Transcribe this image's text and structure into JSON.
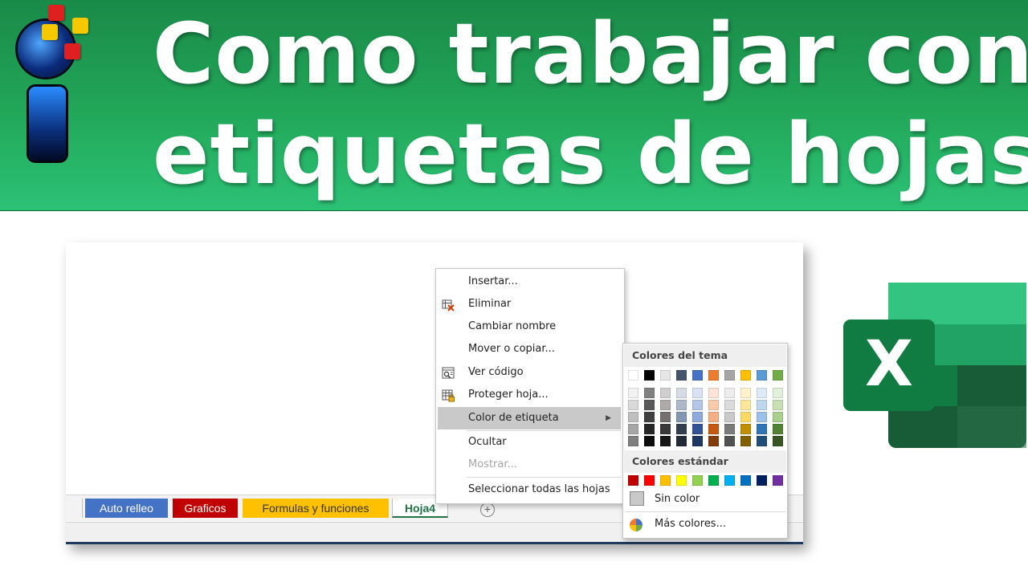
{
  "banner": {
    "title_line1": "Como trabajar con",
    "title_line2": "etiquetas de hojas"
  },
  "tabs": [
    {
      "label": "Auto relleo",
      "color": "#4472C4",
      "text_color": "#ffffff"
    },
    {
      "label": "Graficos",
      "color": "#C00000",
      "text_color": "#ffffff"
    },
    {
      "label": "Formulas y funciones",
      "color": "#FFC000",
      "text_color": "#333333"
    },
    {
      "label": "Hoja4",
      "color": "#ffffff",
      "text_color": "#217346",
      "active": true
    }
  ],
  "new_sheet_symbol": "+",
  "context_menu": {
    "items": [
      {
        "label": "Insertar...",
        "icon": ""
      },
      {
        "label": "Eliminar",
        "icon": "delete-sheet-icon"
      },
      {
        "label": "Cambiar nombre",
        "icon": ""
      },
      {
        "label": "Mover o copiar...",
        "icon": ""
      },
      {
        "label": "Ver código",
        "icon": "view-code-icon"
      },
      {
        "label": "Proteger hoja...",
        "icon": "protect-sheet-icon"
      },
      {
        "label": "Color de etiqueta",
        "icon": "",
        "submenu_arrow": "▶",
        "state": "highlighted"
      },
      {
        "label": "Ocultar",
        "icon": ""
      },
      {
        "label": "Mostrar...",
        "icon": "",
        "state": "disabled"
      },
      {
        "label": "Seleccionar todas las hojas",
        "icon": ""
      }
    ]
  },
  "color_palette": {
    "theme_header": "Colores del tema",
    "theme_colors": [
      "#FFFFFF",
      "#000000",
      "#E7E6E6",
      "#44546A",
      "#4472C4",
      "#ED7D31",
      "#A5A5A5",
      "#FFC000",
      "#5B9BD5",
      "#70AD47"
    ],
    "theme_shades": [
      [
        "#F2F2F2",
        "#D9D9D9",
        "#BFBFBF",
        "#A6A6A6",
        "#808080"
      ],
      [
        "#808080",
        "#595959",
        "#404040",
        "#262626",
        "#0D0D0D"
      ],
      [
        "#D0CECE",
        "#AEAAAA",
        "#757171",
        "#3A3838",
        "#171616"
      ],
      [
        "#D6DCE4",
        "#ADB9CA",
        "#8497B0",
        "#333F4F",
        "#222A35"
      ],
      [
        "#D9E1F2",
        "#B4C6E7",
        "#8EA9DB",
        "#305496",
        "#203764"
      ],
      [
        "#FCE4D6",
        "#F8CBAD",
        "#F4B084",
        "#C65911",
        "#833C0C"
      ],
      [
        "#EDEDED",
        "#DBDBDB",
        "#C9C9C9",
        "#7B7B7B",
        "#525252"
      ],
      [
        "#FFF2CC",
        "#FFE699",
        "#FFD966",
        "#BF8F00",
        "#806000"
      ],
      [
        "#DDEBF7",
        "#BDD7EE",
        "#9BC2E6",
        "#2F75B5",
        "#1F4E78"
      ],
      [
        "#E2EFDA",
        "#C6E0B4",
        "#A9D08E",
        "#548235",
        "#375623"
      ]
    ],
    "standard_header": "Colores estándar",
    "standard_colors": [
      "#C00000",
      "#FF0000",
      "#FFC000",
      "#FFFF00",
      "#92D050",
      "#00B050",
      "#00B0F0",
      "#0070C0",
      "#002060",
      "#7030A0"
    ],
    "no_color_label": "Sin color",
    "more_colors_label": "Más colores..."
  },
  "excel_logo_letter": "X"
}
